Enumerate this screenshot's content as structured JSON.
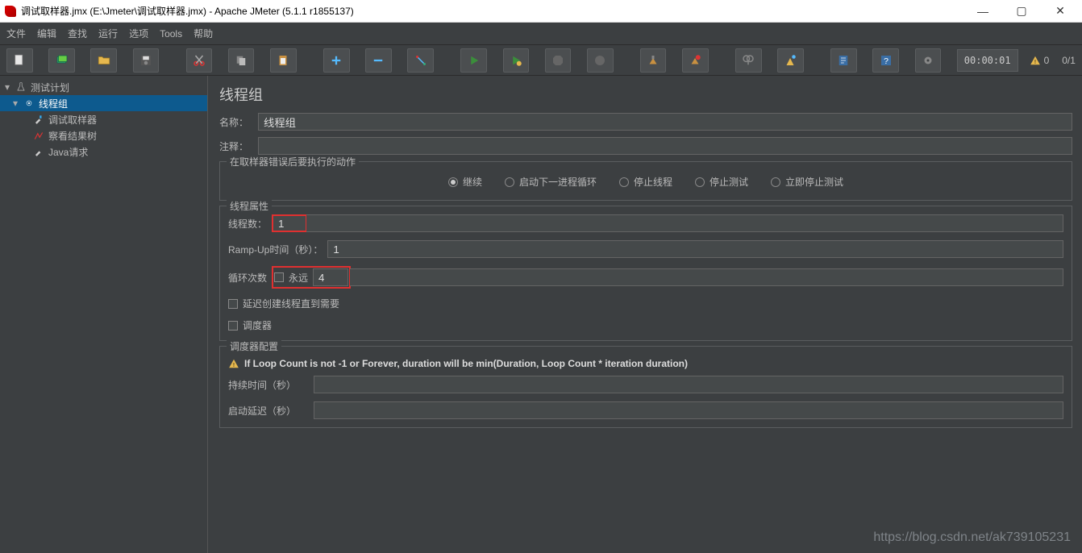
{
  "window": {
    "title": "调试取样器.jmx (E:\\Jmeter\\调试取样器.jmx) - Apache JMeter (5.1.1 r1855137)"
  },
  "menu": {
    "file": "文件",
    "edit": "编辑",
    "search": "查找",
    "run": "运行",
    "options": "选项",
    "tools": "Tools",
    "help": "帮助"
  },
  "toolbar": {
    "timer": "00:00:01",
    "warn_count": "0",
    "thread_count": "0/1"
  },
  "tree": {
    "root": "测试计划",
    "group": "线程组",
    "sampler": "调试取样器",
    "results": "察看结果树",
    "java": "Java请求"
  },
  "panel": {
    "title": "线程组",
    "name_label": "名称：",
    "name_value": "线程组",
    "comment_label": "注释："
  },
  "onerror": {
    "legend": "在取样器错误后要执行的动作",
    "continue": "继续",
    "next_loop": "启动下一进程循环",
    "stop_thread": "停止线程",
    "stop_test": "停止测试",
    "stop_now": "立即停止测试"
  },
  "props": {
    "legend": "线程属性",
    "threads_label": "线程数：",
    "threads_value": "1",
    "rampup_label": "Ramp-Up时间（秒）：",
    "rampup_value": "1",
    "loops_label": "循环次数",
    "forever_label": "永远",
    "loops_value": "4",
    "delay_create_label": "延迟创建线程直到需要",
    "scheduler_label": "调度器"
  },
  "scheduler": {
    "legend": "调度器配置",
    "warning": "If Loop Count is not -1 or Forever, duration will be min(Duration, Loop Count * iteration duration)",
    "duration_label": "持续时间（秒）",
    "delay_label": "启动延迟（秒）"
  },
  "watermark": "https://blog.csdn.net/ak739105231"
}
